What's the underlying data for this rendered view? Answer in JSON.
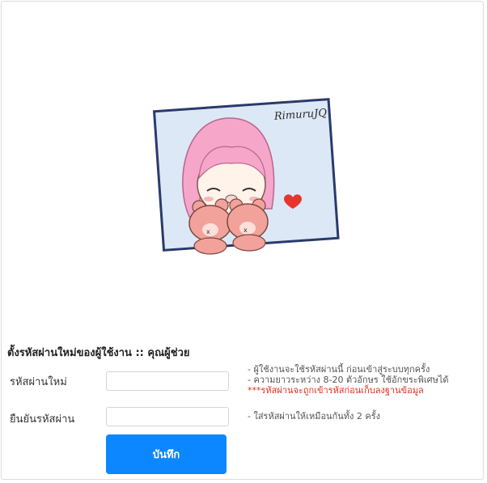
{
  "illustration": {
    "signature": "RimuruJQ",
    "colors": {
      "hair": "#f5a6c9",
      "bears": "#f2a29a",
      "frame": "#2a3a6b",
      "background": "#dce8f5",
      "heart": "#e6352e"
    }
  },
  "form": {
    "title": "ตั้งรหัสผ่านใหม่ของผู้ใช้งาน :: คุณผู้ช่วย",
    "new_password": {
      "label": "รหัสผ่านใหม่",
      "value": "",
      "placeholder": ""
    },
    "confirm_password": {
      "label": "ยืนยันรหัสผ่าน",
      "value": "",
      "placeholder": ""
    },
    "hints": {
      "line1": "- ผู้ใช้งานจะใช้รหัสผ่านนี้ ก่อนเข้าสู่ระบบทุกครั้ง",
      "line2": "- ความยาวระหว่าง 8-20 ตัวอักษร ใช้อักขระพิเศษได้",
      "line3": "***รหัสผ่านจะถูกเข้ารหัสก่อนเก็บลงฐานข้อมูล",
      "confirm": "- ใส่รหัสผ่านให้เหมือนกันทั้ง 2 ครั้ง"
    },
    "save_label": "บันทึก",
    "accent": "#0d87ff",
    "warning_color": "#e0301e"
  }
}
